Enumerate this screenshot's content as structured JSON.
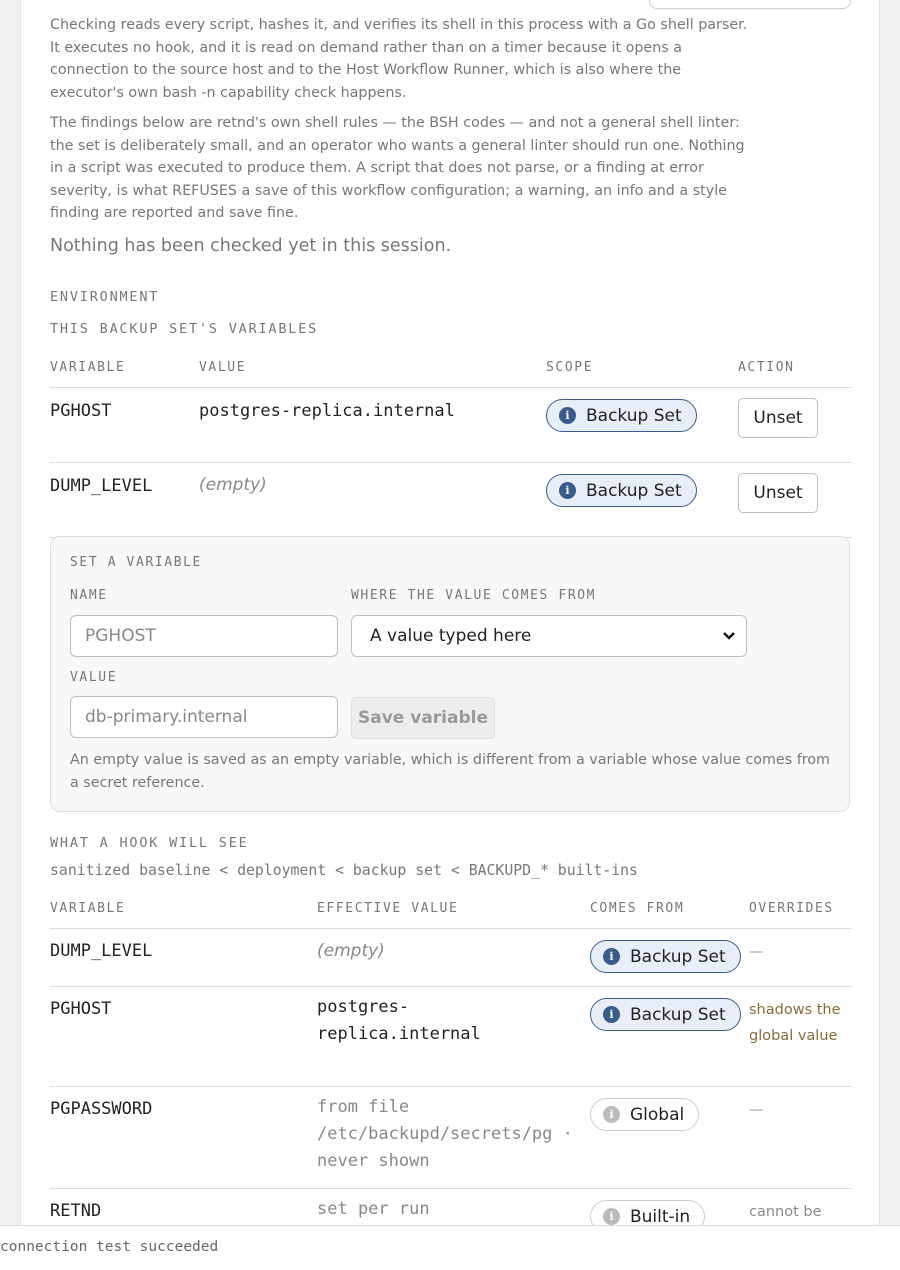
{
  "checking": {
    "intro": "Checking reads every script, hashes it, and verifies its shell in this process with a Go shell parser. It executes no hook, and it is read on demand rather than on a timer because it opens a connection to the source host and to the Host Workflow Runner, which is also where the executor's own bash -n capability check happens.",
    "findings_note": "The findings below are retnd's own shell rules — the BSH codes — and not a general shell linter: the set is deliberately small, and an operator who wants a general linter should run one. Nothing in a script was executed to produce them. A script that does not parse, or a finding at error severity, is what REFUSES a save of this workflow configuration; a warning, an info and a style finding are reported and save fine.",
    "status": "Nothing has been checked yet in this session."
  },
  "environment": {
    "section_label": "ENVIRONMENT",
    "subsection_label": "THIS BACKUP SET'S VARIABLES",
    "columns": [
      "VARIABLE",
      "VALUE",
      "SCOPE",
      "ACTION"
    ],
    "rows": [
      {
        "name": "PGHOST",
        "value": "postgres-replica.internal",
        "empty": false,
        "scope": "Backup Set",
        "action": "Unset"
      },
      {
        "name": "DUMP_LEVEL",
        "value": "(empty)",
        "empty": true,
        "scope": "Backup Set",
        "action": "Unset"
      }
    ]
  },
  "set_variable": {
    "title": "SET A VARIABLE",
    "name_label": "NAME",
    "name_placeholder": "PGHOST",
    "source_label": "WHERE THE VALUE COMES FROM",
    "source_selected": "A value typed here",
    "value_label": "VALUE",
    "value_placeholder": "db-primary.internal",
    "save_label": "Save variable",
    "hint": "An empty value is saved as an empty variable, which is different from a variable whose value comes from a secret reference."
  },
  "hook_view": {
    "title": "WHAT A HOOK WILL SEE",
    "chain": "sanitized baseline < deployment < backup set < BACKUPD_* built-ins",
    "columns": [
      "VARIABLE",
      "EFFECTIVE VALUE",
      "COMES FROM",
      "OVERRIDES"
    ],
    "rows": [
      {
        "name": "DUMP_LEVEL",
        "value": "(empty)",
        "kind": "empty",
        "source": "Backup Set",
        "source_kind": "set",
        "overrides": "—"
      },
      {
        "name": "PGHOST",
        "value": "postgres-replica.internal",
        "kind": "value",
        "source": "Backup Set",
        "source_kind": "set",
        "overrides": "shadows the global value"
      },
      {
        "name": "PGPASSWORD",
        "value": "from file /etc/backupd/secrets/pg · never shown",
        "kind": "muted",
        "source": "Global",
        "source_kind": "global",
        "overrides": "—"
      },
      {
        "name": "RETND",
        "value": "set per run",
        "kind": "muted",
        "source": "Built-in",
        "source_kind": "global",
        "overrides": "cannot be"
      }
    ]
  },
  "footer": {
    "message": "connection test succeeded"
  },
  "colors": {
    "accent": "#3a5c8c",
    "scope_pill_bg": "#e7eef8",
    "override_text": "#8a6a3a"
  },
  "icons": {
    "scope": "info-icon"
  }
}
